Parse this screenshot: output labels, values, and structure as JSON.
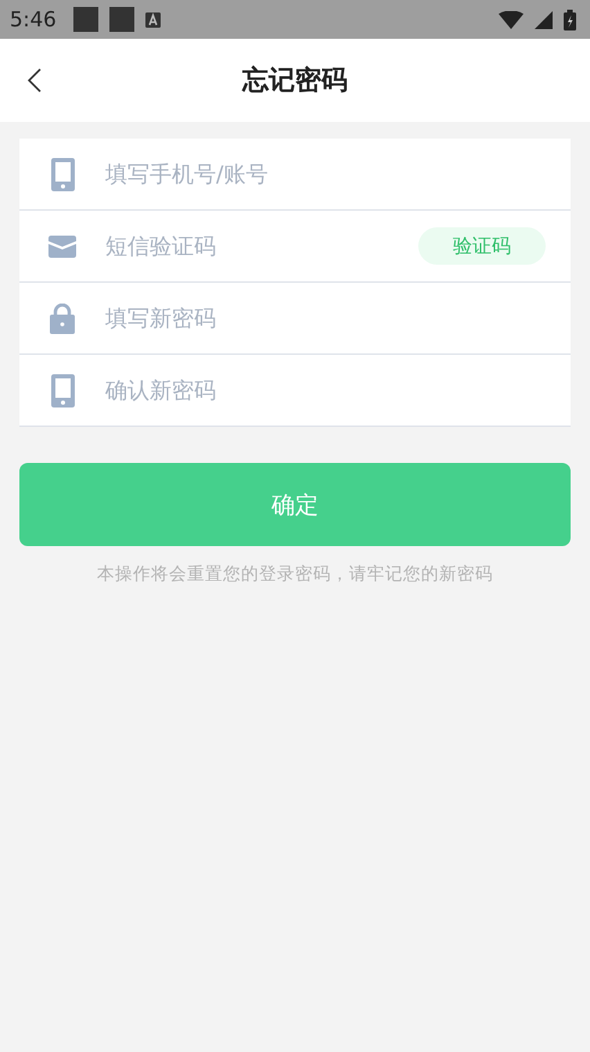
{
  "status_bar": {
    "time": "5:46"
  },
  "header": {
    "title": "忘记密码"
  },
  "fields": [
    {
      "kind": "phone",
      "placeholder": "填写手机号/账号"
    },
    {
      "kind": "mail",
      "placeholder": "短信验证码",
      "action": "验证码"
    },
    {
      "kind": "lock",
      "placeholder": "填写新密码"
    },
    {
      "kind": "phone",
      "placeholder": "确认新密码"
    }
  ],
  "submit": "确定",
  "note": "本操作将会重置您的登录密码，请牢记您的新密码"
}
